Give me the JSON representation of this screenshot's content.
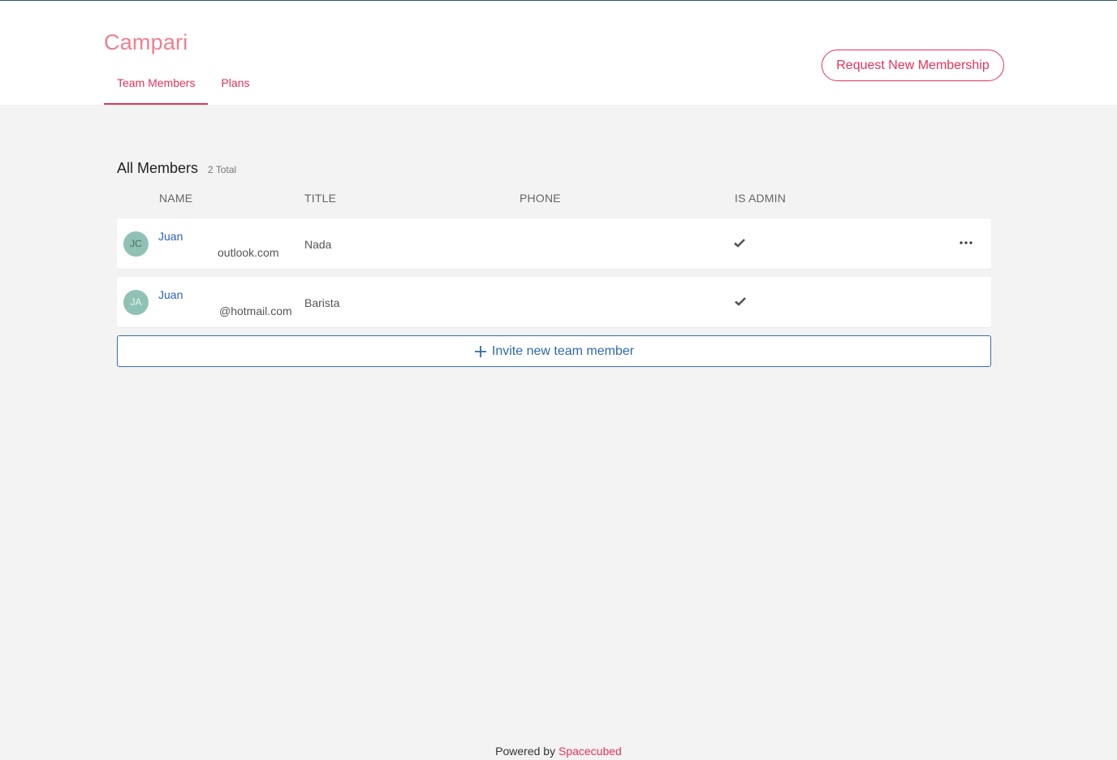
{
  "org": {
    "name": "Campari"
  },
  "tabs": [
    {
      "label": "Team Members",
      "active": true
    },
    {
      "label": "Plans",
      "active": false
    }
  ],
  "header": {
    "request_button": "Request New Membership"
  },
  "members_section": {
    "title": "All Members",
    "total": "2 Total"
  },
  "columns": {
    "name": "NAME",
    "title": "TITLE",
    "phone": "PHONE",
    "is_admin": "IS ADMIN"
  },
  "members": [
    {
      "initials": "JC",
      "name": "Juan",
      "email": "outlook.com",
      "title": "Nada",
      "phone": "",
      "is_admin": true
    },
    {
      "initials": "JA",
      "name": "Juan",
      "email": "@hotmail.com",
      "title": "Barista",
      "phone": "",
      "is_admin": true
    }
  ],
  "invite": {
    "label": "Invite new team member"
  },
  "footer": {
    "powered_by": "Powered by",
    "brand": "Spacecubed"
  },
  "colors": {
    "accent": "#e8325a",
    "link": "#2b5fc0",
    "avatar": "#8fc2b5"
  }
}
